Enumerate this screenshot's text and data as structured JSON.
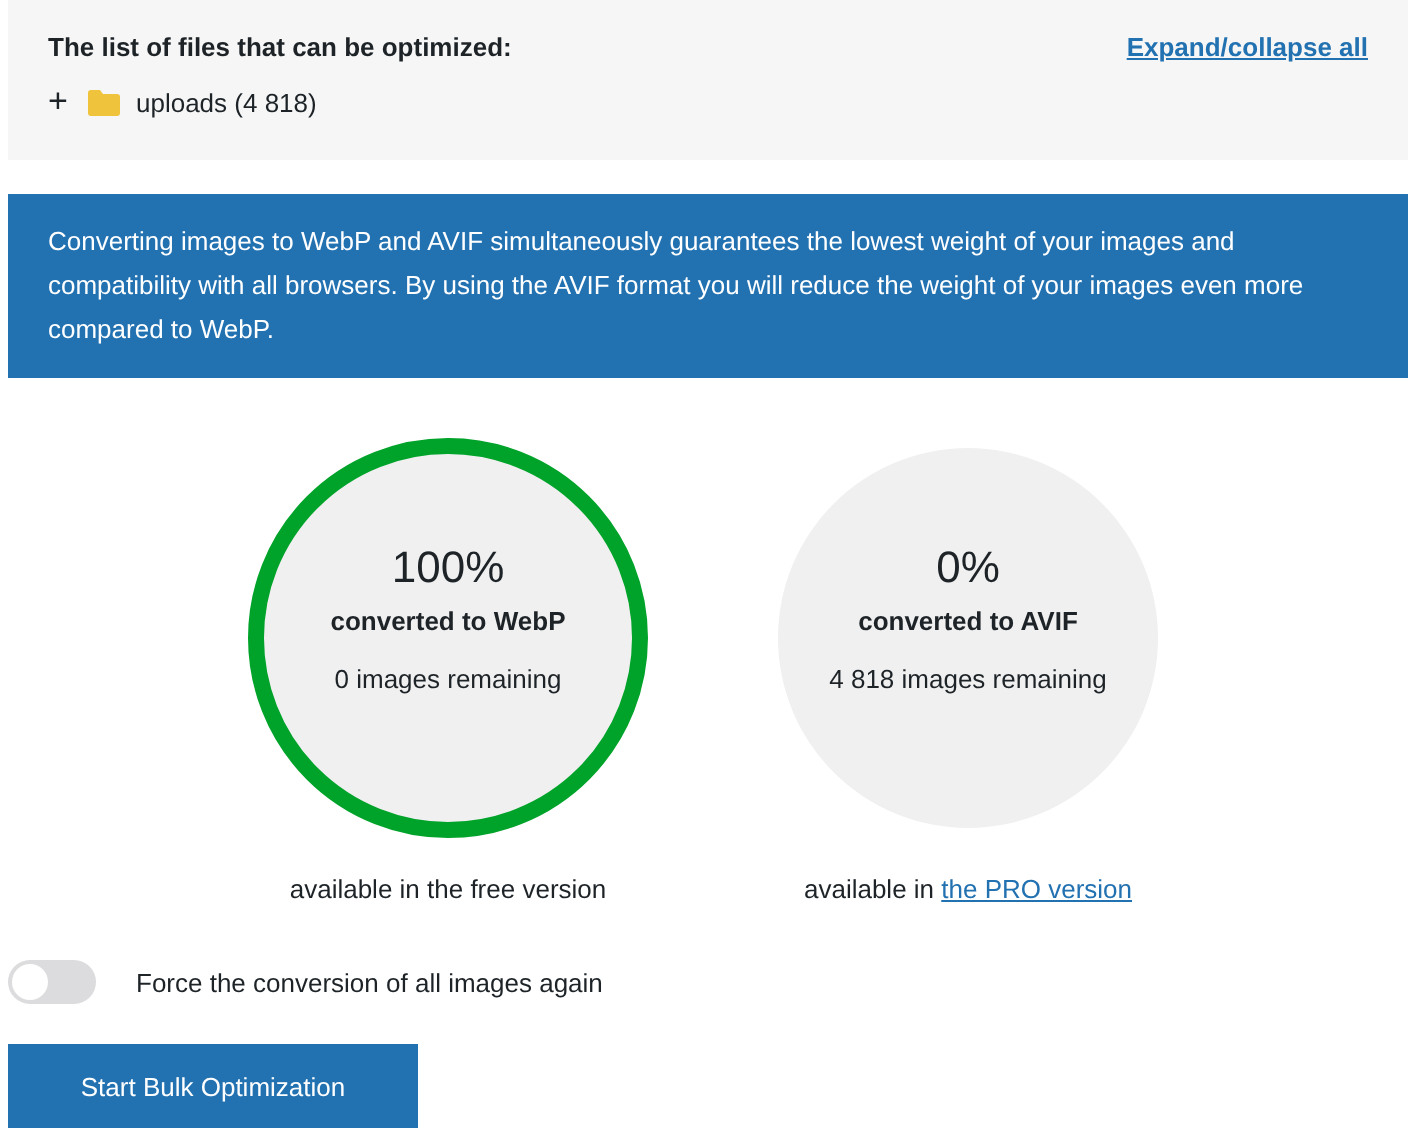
{
  "files_panel": {
    "title": "The list of files that can be optimized:",
    "toggle_all": "Expand/collapse all",
    "tree": [
      {
        "expander": "+",
        "label": "uploads (4 818)",
        "expanded": false
      }
    ]
  },
  "notice": "Converting images to WebP and AVIF simultaneously guarantees the lowest weight of your images and compatibility with all browsers. By using the AVIF format you will reduce the weight of your images even more compared to WebP.",
  "stats": [
    {
      "percent": "100%",
      "label": "converted to WebP",
      "remaining": "0 images remaining",
      "completed": true,
      "caption": "available in the free version"
    },
    {
      "percent": "0%",
      "label": "converted to AVIF",
      "remaining": "4 818 images remaining",
      "completed": false,
      "caption": "available in ",
      "caption_link": "the PRO version"
    }
  ],
  "force_option": {
    "label": "Force the conversion of all images again",
    "on": false
  },
  "start_button": "Start Bulk Optimization"
}
